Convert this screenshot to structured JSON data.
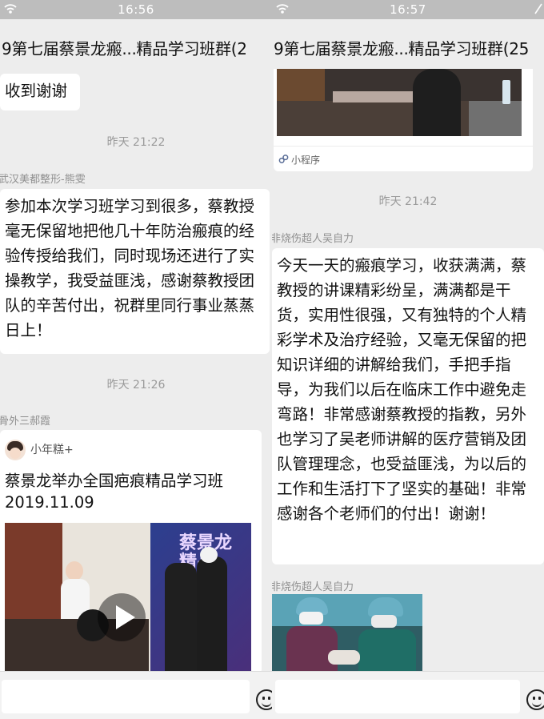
{
  "left": {
    "status_time": "16:56",
    "title": "9第七届蔡景龙瘢...精品学习班群(2",
    "msg_received": "收到谢谢",
    "ts1": "昨天 21:22",
    "sender1": "武汉美都整形-熊雯",
    "msg1": "参加本次学习班学习到很多，蔡教授毫无保留地把他几十年防治瘢痕的经验传授给我们，同时现场还进行了实操教学，我受益匪浅，感谢蔡教授团队的辛苦付出，祝群里同行事业蒸蒸日上！",
    "ts2": "昨天 21:26",
    "sender2": "骨外三郝霞",
    "card": {
      "account": "小年糕+",
      "title": "蔡景龙举办全国疤痕精品学习班2019.11.09",
      "video_overlay": "蔡景龙 精品"
    }
  },
  "right": {
    "status_time": "16:57",
    "title": "9第七届蔡景龙瘢...精品学习班群(25",
    "mini_program_label": "小程序",
    "ts1": "昨天 21:42",
    "sender1": "非烧伤超人吴自力",
    "msg1": "今天一天的瘢痕学习，收获满满，蔡教授的讲课精彩纷呈，满满都是干货，实用性很强，又有独特的个人精彩学术及治疗经验，又毫无保留的把知识详细的讲解给我们，手把手指导，为我们以后在临床工作中避免走弯路！非常感谢蔡教授的指教，另外也学习了吴老师讲解的医疗营销及团队管理理念，也受益匪浅，为以后的工作和生活打下了坚实的基础！非常感谢各个老师们的付出！谢谢！",
    "sender2": "非烧伤超人吴自力"
  },
  "colors": {
    "chat_bg": "#ededed",
    "bubble_bg": "#ffffff",
    "status_bar": "#bdbdbd",
    "mini_program_blue": "#576b95"
  }
}
